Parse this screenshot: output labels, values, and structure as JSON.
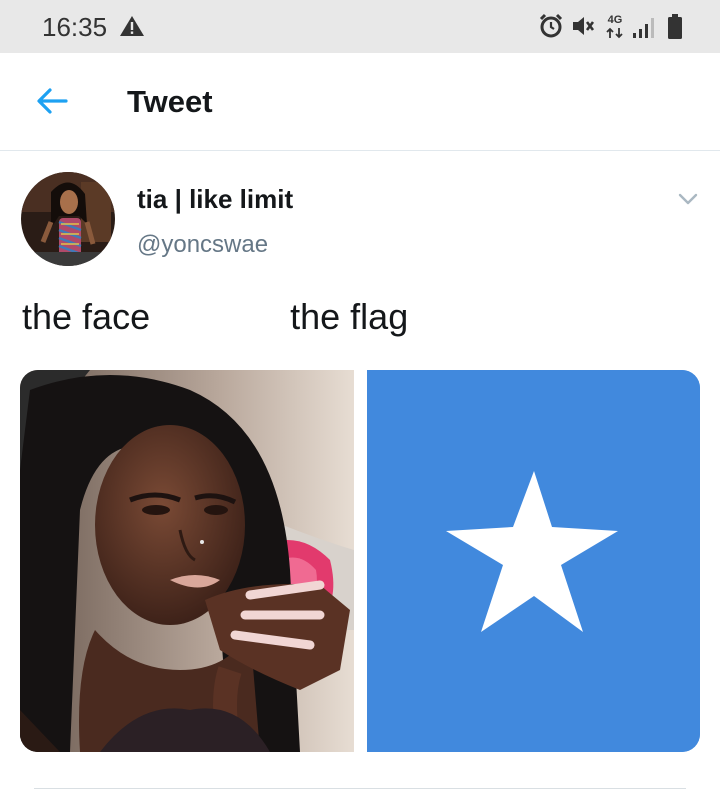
{
  "status_bar": {
    "time": "16:35",
    "network_label_top": "4G",
    "icons": [
      "warning-icon",
      "alarm-icon",
      "mute-icon",
      "network-4g-icon",
      "signal-icon",
      "battery-icon"
    ]
  },
  "header": {
    "title": "Tweet",
    "back_icon": "arrow-left-icon"
  },
  "tweet": {
    "display_name": "tia | like limit",
    "handle": "@yoncswae",
    "text": "the face              the flag",
    "media": [
      {
        "name": "selfie-photo"
      },
      {
        "name": "somalia-flag-image",
        "star_icon": "star"
      }
    ]
  },
  "colors": {
    "accent": "#1da1f2",
    "flag_blue": "#4189dd",
    "secondary_text": "#657786",
    "status_bar_bg": "#e8e8e8"
  }
}
